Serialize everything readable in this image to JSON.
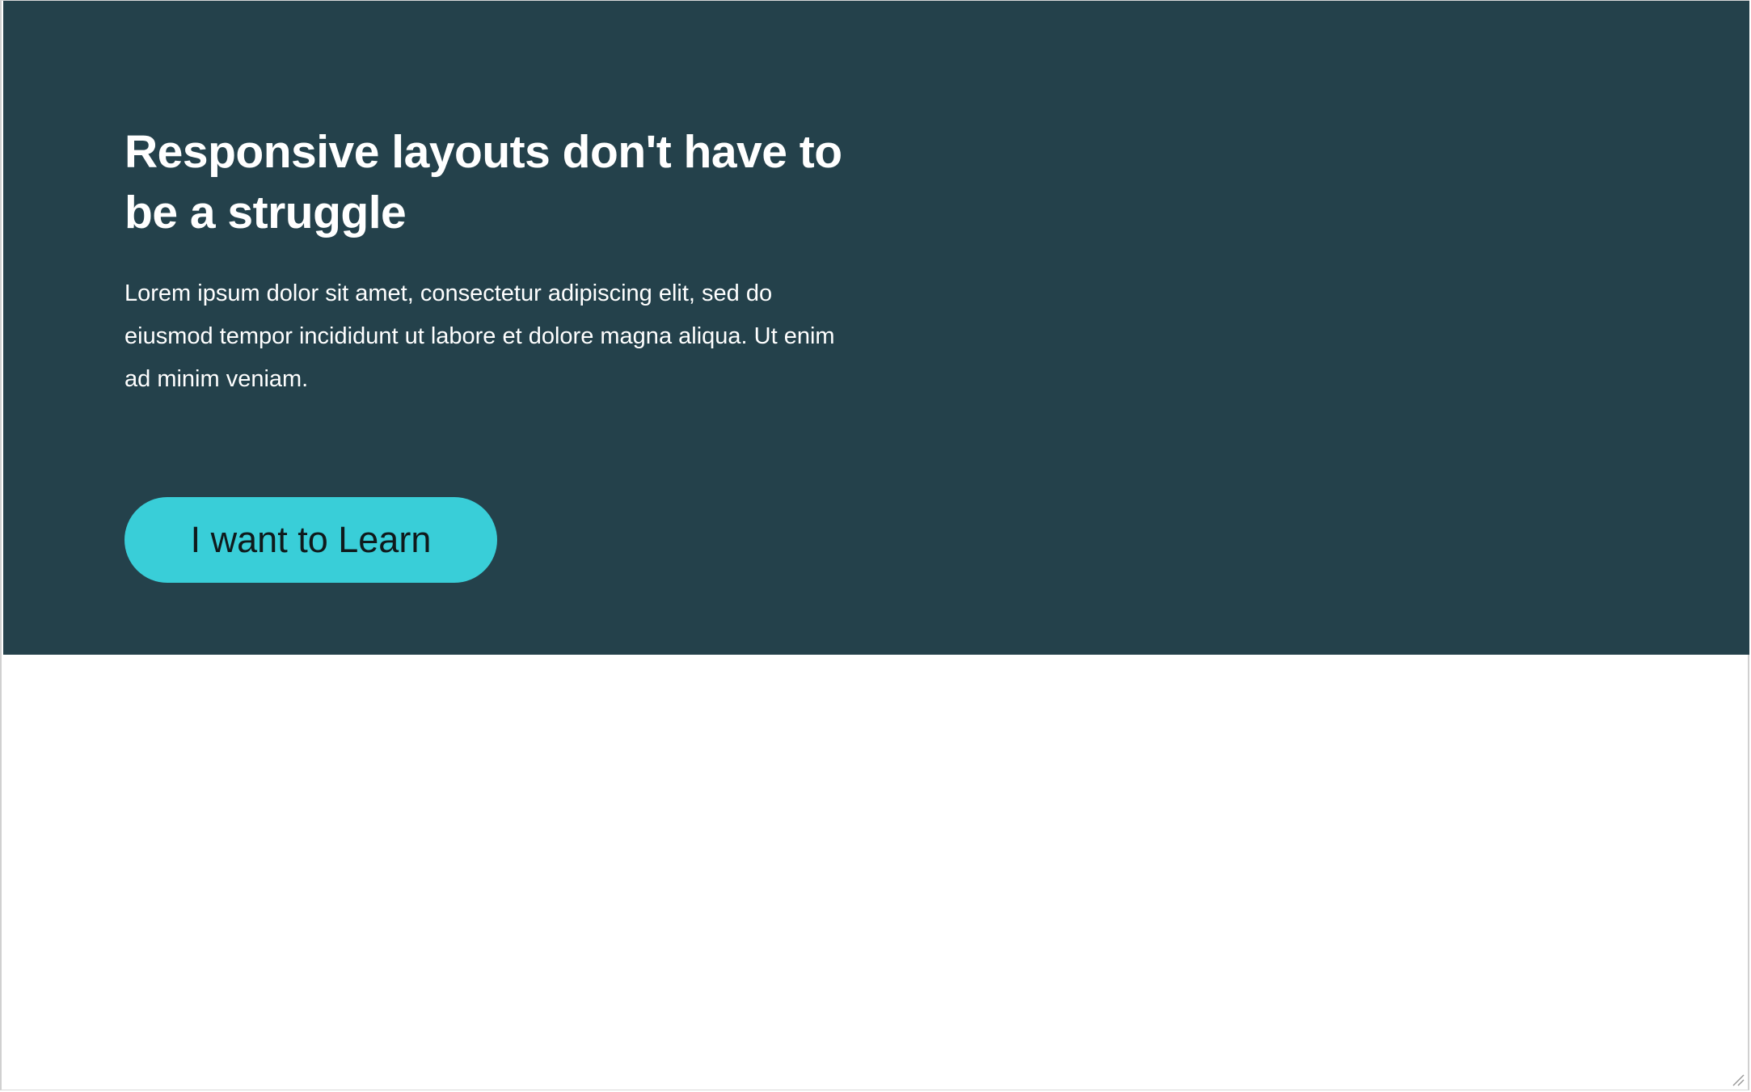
{
  "hero": {
    "title": "Responsive layouts don't have to be a struggle",
    "text": "Lorem ipsum dolor sit amet, consectetur adipiscing elit, sed do eiusmod tempor incididunt ut labore et dolore magna aliqua. Ut enim ad minim veniam.",
    "button_label": "I want to Learn"
  },
  "colors": {
    "hero_background": "#24414b",
    "button_background": "#39ced8",
    "page_background": "#ffffff"
  },
  "icons": {
    "resize_handle": "resize-grip-icon"
  }
}
